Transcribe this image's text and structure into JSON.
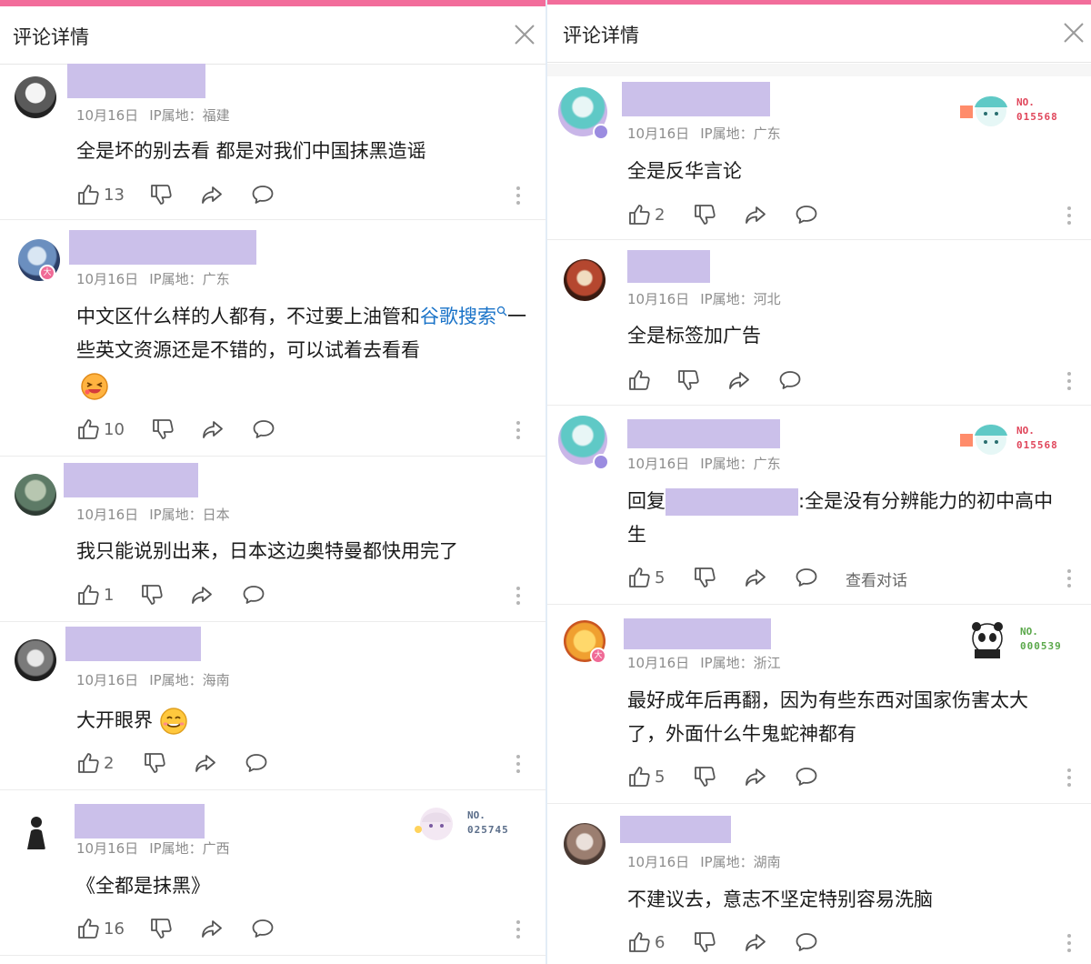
{
  "left": {
    "title": "评论详情",
    "comments": [
      {
        "date": "10月16日",
        "ip": "IP属地：福建",
        "text": "全是坏的别去看 都是对我们中国抹黑造谣",
        "likes": "13"
      },
      {
        "date": "10月16日",
        "ip": "IP属地：广东",
        "text_before": "中文区什么样的人都有，不过要上油管和",
        "link": "谷歌搜索",
        "text_after": "一些英文资源还是不错的，可以试着去看看",
        "likes": "10"
      },
      {
        "date": "10月16日",
        "ip": "IP属地：日本",
        "text": "我只能说别出来，日本这边奥特曼都快用完了",
        "likes": "1"
      },
      {
        "date": "10月16日",
        "ip": "IP属地：海南",
        "text": "大开眼界",
        "likes": "2"
      },
      {
        "date": "10月16日",
        "ip": "IP属地：广西",
        "text": "《全都是抹黑》",
        "likes": "16",
        "no_label": "NO.",
        "no_number": "025745"
      }
    ]
  },
  "right": {
    "title": "评论详情",
    "comments": [
      {
        "date": "10月16日",
        "ip": "IP属地：广东",
        "text": "全是反华言论",
        "likes": "2",
        "no_label": "NO.",
        "no_number": "015568"
      },
      {
        "date": "10月16日",
        "ip": "IP属地：河北",
        "text": "全是标签加广告",
        "likes": ""
      },
      {
        "date": "10月16日",
        "ip": "IP属地：广东",
        "reply_prefix": "回复",
        "text": ":全是没有分辨能力的初中高中",
        "text_line2": "生",
        "likes": "5",
        "no_label": "NO.",
        "no_number": "015568",
        "view_thread": "查看对话"
      },
      {
        "date": "10月16日",
        "ip": "IP属地：浙江",
        "text": "最好成年后再翻，因为有些东西对国家伤害太大",
        "text_line2": "了，外面什么牛鬼蛇神都有",
        "likes": "5",
        "no_label": "NO.",
        "no_number": "000539"
      },
      {
        "date": "10月16日",
        "ip": "IP属地：湖南",
        "text": "不建议去，意志不坚定特别容易洗脑",
        "likes": "6"
      }
    ]
  },
  "colors": {
    "accent_pink": "#f26d9b",
    "mask": "#cbc0ea",
    "link": "#1a73c8",
    "no_red": "#e0465b",
    "no_green": "#5aa84a",
    "no_blue": "#5b6e8a"
  },
  "icons": [
    "close-icon",
    "thumbs-up-icon",
    "thumbs-down-icon",
    "share-icon",
    "comment-icon",
    "more-icon",
    "search-icon"
  ]
}
